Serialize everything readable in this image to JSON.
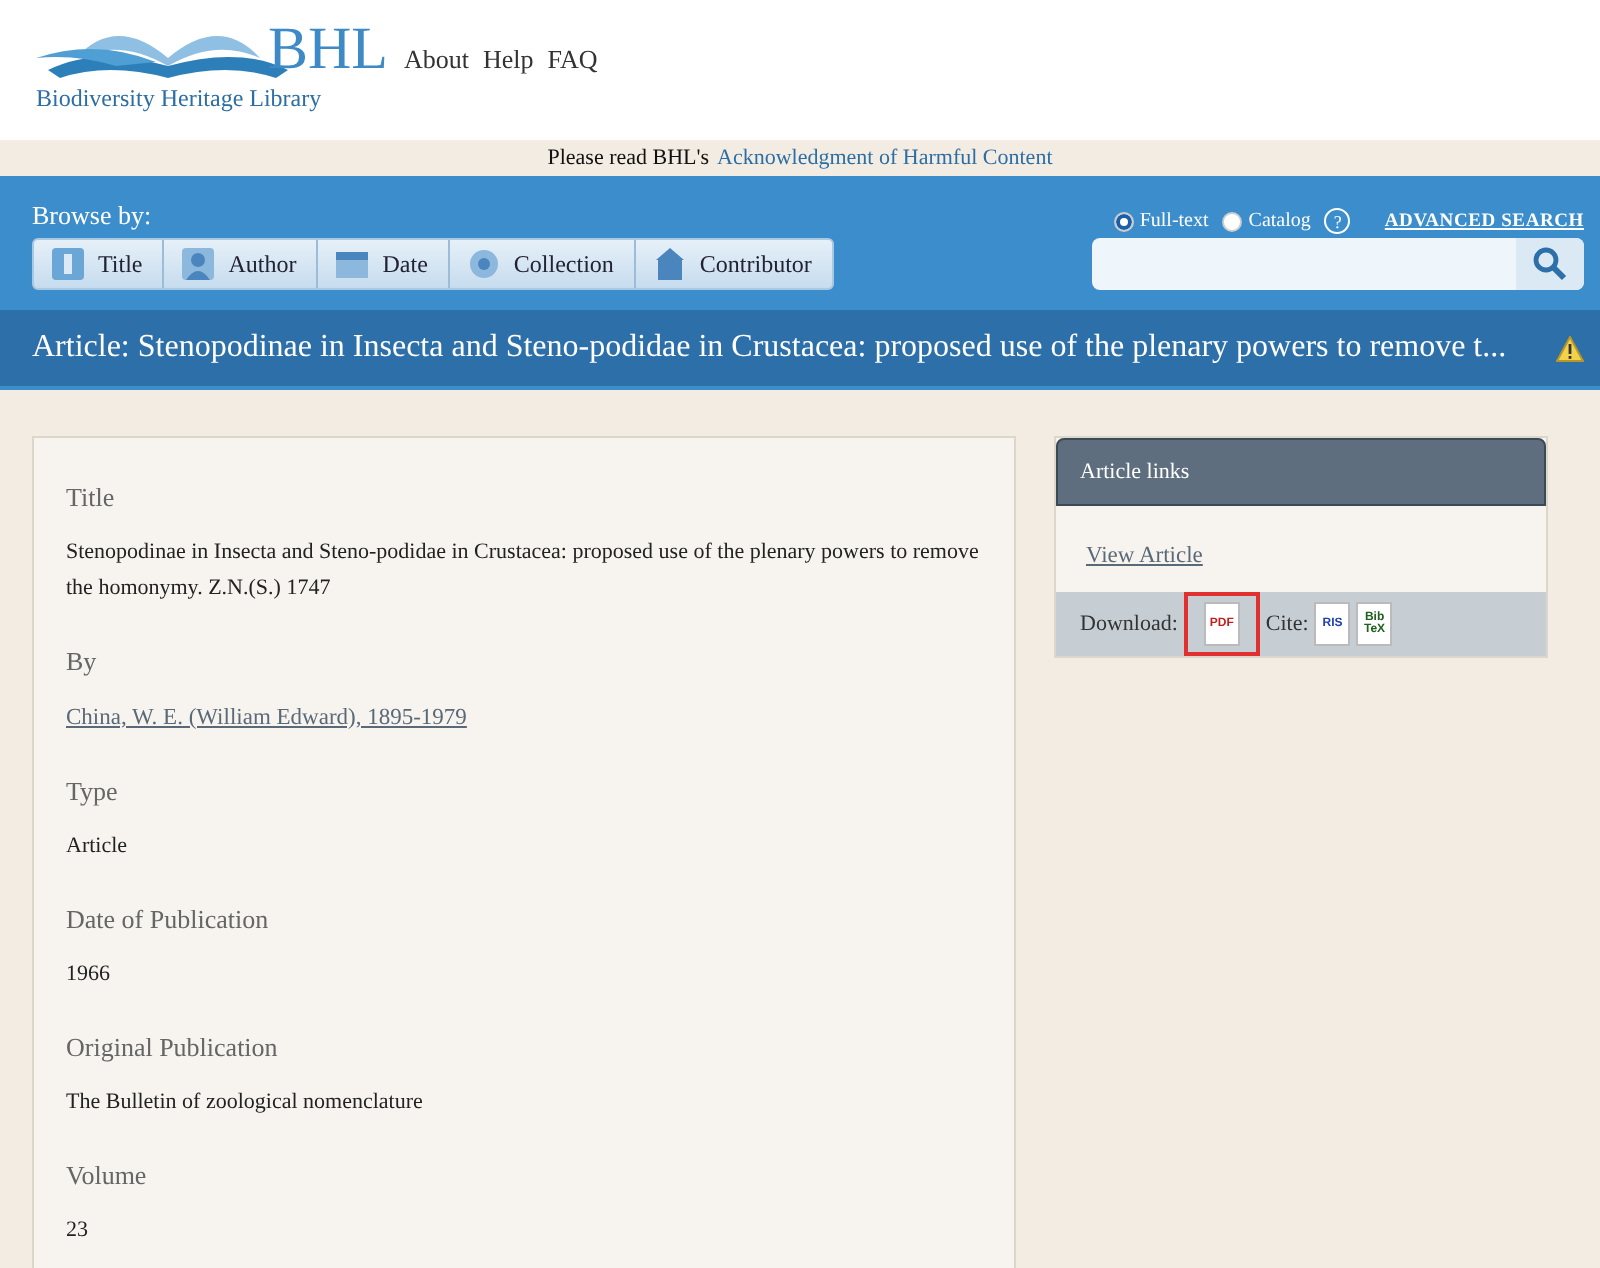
{
  "header": {
    "logo_text": "BHL",
    "logo_subtitle": "Biodiversity Heritage Library",
    "links": [
      "About",
      "Help",
      "FAQ"
    ]
  },
  "notice": {
    "text": "Please read BHL's",
    "link": "Acknowledgment of Harmful Content"
  },
  "browse": {
    "label": "Browse by:",
    "buttons": [
      {
        "label": "Title",
        "kind": "title"
      },
      {
        "label": "Author",
        "kind": "author"
      },
      {
        "label": "Date",
        "kind": "date"
      },
      {
        "label": "Collection",
        "kind": "collection"
      },
      {
        "label": "Contributor",
        "kind": "contributor"
      }
    ]
  },
  "search": {
    "modes": [
      {
        "label": "Full-text",
        "selected": true
      },
      {
        "label": "Catalog",
        "selected": false
      }
    ],
    "help": "?",
    "advanced": "ADVANCED SEARCH"
  },
  "page_title": "Article: Stenopodinae in Insecta and Steno-podidae in Crustacea: proposed use of the plenary powers to remove t...",
  "fields": [
    {
      "label": "Title",
      "value": "Stenopodinae in Insecta and Steno-podidae in Crustacea: proposed use of the plenary powers to remove the homonymy. Z.N.(S.) 1747",
      "kind": "text"
    },
    {
      "label": "By",
      "value": "China, W. E. (William Edward), 1895-1979",
      "kind": "link"
    },
    {
      "label": "Type",
      "value": "Article",
      "kind": "text"
    },
    {
      "label": "Date of Publication",
      "value": "1966",
      "kind": "text"
    },
    {
      "label": "Original Publication",
      "value": "The Bulletin of zoological nomenclature",
      "kind": "text"
    },
    {
      "label": "Volume",
      "value": "23",
      "kind": "text"
    }
  ],
  "article_links": {
    "title": "Article links",
    "view": "View Article",
    "download_label": "Download:",
    "downloads": [
      {
        "label": "PDF",
        "highlighted": true
      }
    ],
    "cite_label": "Cite:",
    "cites": [
      {
        "label": "RIS",
        "kind": "ris"
      },
      {
        "label": "Bib\nTeX",
        "kind": "bibtex"
      }
    ]
  }
}
